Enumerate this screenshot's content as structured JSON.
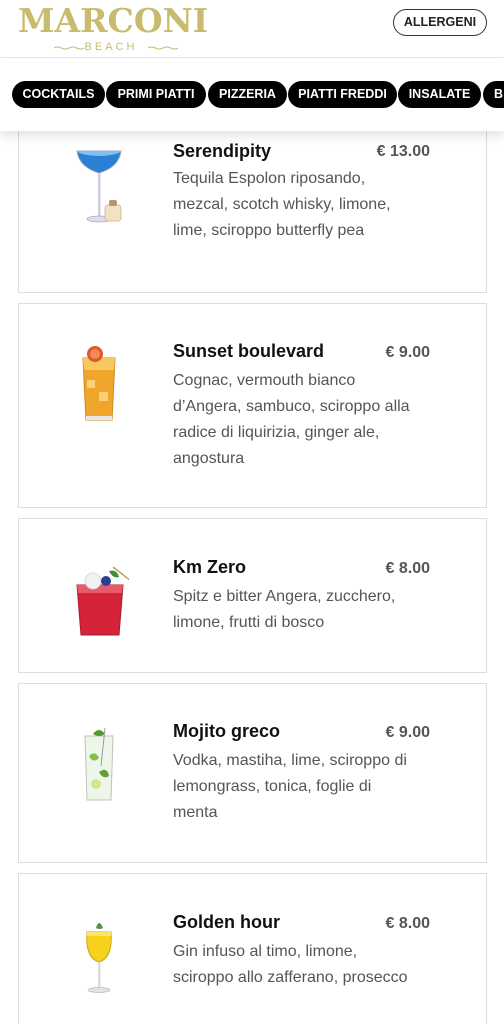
{
  "header": {
    "logo_main": "MARCONI",
    "logo_sub": "BEACH",
    "allergens_label": "ALLERGENI",
    "brand_color": "#c8bb6e"
  },
  "categories": [
    {
      "label": "COCKTAILS"
    },
    {
      "label": "PRIMI PIATTI"
    },
    {
      "label": "PIZZERIA"
    },
    {
      "label": "PIATTI FREDDI"
    },
    {
      "label": "INSALATE"
    },
    {
      "label": "B"
    }
  ],
  "items": [
    {
      "name": "Serendipity",
      "price": "€ 13.00",
      "description": "Tequila Espolon riposando, mezcal, scotch whisky, limone, lime, sciroppo butterfly pea",
      "icon": "blue-coupe-cocktail-icon"
    },
    {
      "name": "Sunset boulevard",
      "price": "€ 9.00",
      "description": "Cognac, vermouth bianco d’Angera, sambuco, sciroppo alla radice di liquirizia, ginger ale, angostura",
      "icon": "amber-highball-cocktail-icon"
    },
    {
      "name": "Km Zero",
      "price": "€ 8.00",
      "description": "Spitz e bitter Angera, zucchero, limone, frutti di bosco",
      "icon": "red-tumbler-cocktail-icon"
    },
    {
      "name": "Mojito greco",
      "price": "€ 9.00",
      "description": "Vodka, mastiha, lime, sciroppo di lemongrass, tonica, foglie di menta",
      "icon": "mojito-glass-icon"
    },
    {
      "name": "Golden hour",
      "price": "€ 8.00",
      "description": "Gin infuso al timo, limone, sciroppo allo zafferano, prosecco",
      "icon": "yellow-wine-glass-icon"
    }
  ]
}
